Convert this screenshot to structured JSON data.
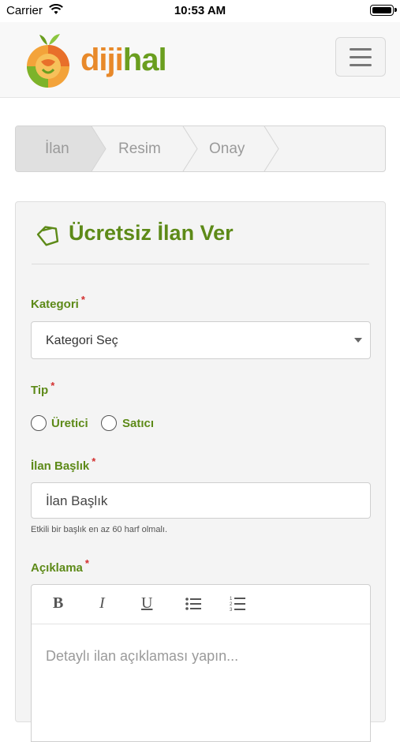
{
  "status_bar": {
    "carrier": "Carrier",
    "time": "10:53 AM"
  },
  "header": {
    "logo_part1": "diji",
    "logo_part2": "hal",
    "menu_icon": "hamburger-icon"
  },
  "steps": [
    {
      "label": "İlan",
      "active": true
    },
    {
      "label": "Resim",
      "active": false
    },
    {
      "label": "Onay",
      "active": false
    }
  ],
  "form": {
    "title": "Ücretsiz İlan Ver",
    "title_icon": "tag-icon",
    "category": {
      "label": "Kategori",
      "value": "Kategori Seç"
    },
    "type": {
      "label": "Tip",
      "options": [
        "Üretici",
        "Satıcı"
      ]
    },
    "title_field": {
      "label": "İlan Başlık",
      "placeholder": "İlan Başlık",
      "hint": "Etkili bir başlık en az 60 harf olmalı."
    },
    "description": {
      "label": "Açıklama",
      "placeholder": "Detaylı ilan açıklaması yapın..."
    },
    "required_mark": "*"
  },
  "editor_toolbar": {
    "bold": "B",
    "italic": "I",
    "underline": "U"
  },
  "colors": {
    "accent_green": "#5d8a18",
    "logo_orange": "#e8892a",
    "required_red": "#d32f2f"
  }
}
